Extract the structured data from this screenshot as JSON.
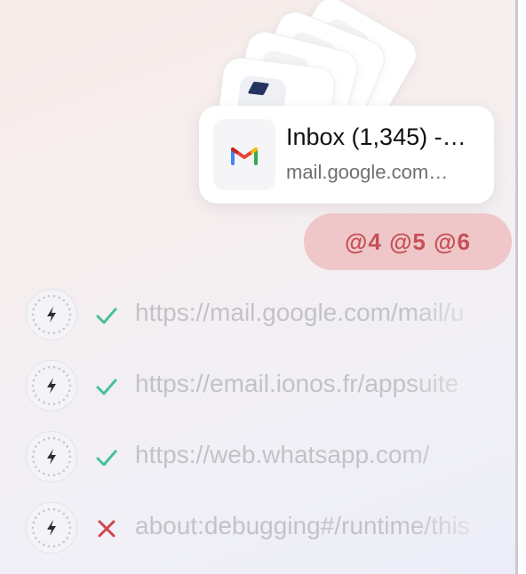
{
  "active_tab": {
    "title": "Inbox (1,345) -…",
    "url": "mail.google.com…",
    "icon": "gmail-icon"
  },
  "mentions": "@4 @5 @6",
  "rows": [
    {
      "url": "https://mail.google.com/mail/u",
      "status": "success",
      "icon": "lightning-icon"
    },
    {
      "url": "https://email.ionos.fr/appsuite",
      "status": "success",
      "icon": "lightning-icon"
    },
    {
      "url": "https://web.whatsapp.com/",
      "status": "success",
      "icon": "lightning-icon"
    },
    {
      "url": "about:debugging#/runtime/this",
      "status": "failed",
      "icon": "lightning-icon"
    }
  ],
  "colors": {
    "success": "#45c29a",
    "failed": "#d2464f",
    "pill_bg": "#efc7c9",
    "pill_text": "#c55056"
  }
}
